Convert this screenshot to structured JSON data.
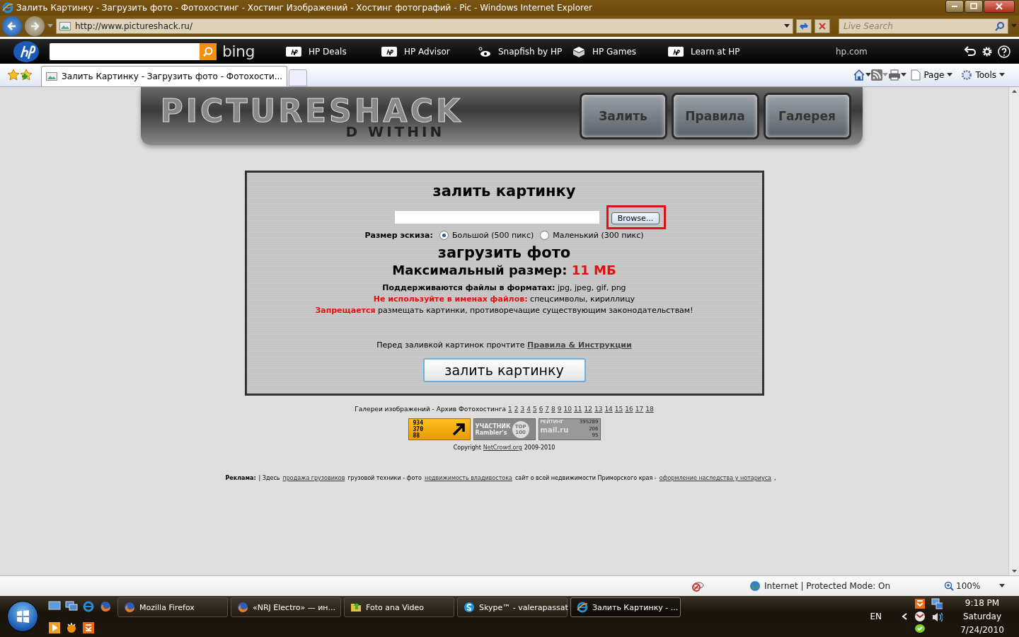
{
  "window": {
    "title": "Залить Картинку - Загрузить фото - Фотохостинг - Хостинг Изображений - Хостинг фотографий - Pic - Windows Internet Explorer"
  },
  "address_bar": {
    "url": "http://www.pictureshack.ru/",
    "search_placeholder": "Live Search"
  },
  "hp_toolbar": {
    "search_brand": "bing",
    "links": [
      "HP Deals",
      "HP Advisor",
      "Snapfish by HP",
      "HP Games",
      "Learn at HP"
    ],
    "site": "hp.com"
  },
  "tabs": [
    {
      "label": "Залить Картинку - Загрузить фото - Фотохости...",
      "selected": true
    }
  ],
  "command_bar": [
    "Page",
    "Tools"
  ],
  "site": {
    "logo": [
      "PICTURESHACK",
      "D WITHIN"
    ],
    "nav": [
      "Залить",
      "Правила",
      "Галерея"
    ]
  },
  "upload": {
    "title": "залить картинку",
    "browse_button": "Browse...",
    "browse_highlighted": true,
    "thumb_label": "Размер эскиза:",
    "size_options": [
      {
        "label": "Большой (500 пикс)",
        "selected": true
      },
      {
        "label": "Маленький (300 пикс)",
        "selected": false
      }
    ],
    "subtitle": "загрузить фото",
    "max_size_label": "Максимальный размер:",
    "max_size_value": "11 МБ",
    "notes": [
      {
        "kind": "info",
        "lead": "Поддерживаются файлы в форматах:",
        "text": "jpg, jpeg, gif, png"
      },
      {
        "kind": "warning",
        "lead": "Не используйте в именах файлов:",
        "text": "спецсимволы, кириллицу"
      },
      {
        "kind": "warning",
        "lead": "Запрещается",
        "text": "размещать картинки, противоречащие существующим законодательствам!"
      }
    ],
    "rules_text": "Перед заливкой картинок прочтите",
    "rules_link": "Правила & Инструкции",
    "submit_button": "залить картинку"
  },
  "galleries": {
    "label": "Галереи изображений - Архив Фотохостинга",
    "pages": [
      "1",
      "2",
      "3",
      "4",
      "5",
      "6",
      "7",
      "8",
      "9",
      "10",
      "11",
      "12",
      "13",
      "14",
      "15",
      "16",
      "17",
      "18"
    ]
  },
  "counters": [
    {
      "kind": "liveinternet",
      "lines": [
        "934",
        "370",
        "88"
      ]
    },
    {
      "kind": "rambler",
      "lines": [
        "УЧАСТНИК",
        "Rambler's",
        "TOP",
        "100"
      ]
    },
    {
      "kind": "mail",
      "lines": [
        "РЕЙТИНГ",
        "395289",
        "206",
        "95",
        "mail.ru"
      ]
    }
  ],
  "copyright": {
    "text": "Copyright",
    "link": "NetCrowd.org",
    "years": "2009-2010"
  },
  "ads": {
    "label": "Реклама:",
    "parts": [
      {
        "kind": "text",
        "text": "|  Здесь"
      },
      {
        "kind": "link",
        "text": "продажа грузовиков"
      },
      {
        "kind": "text",
        "text": "грузовой техники - фото"
      },
      {
        "kind": "link",
        "text": "недвижимость владивостока"
      },
      {
        "kind": "text",
        "text": "сайт о всей недвижимости Приморского края -"
      },
      {
        "kind": "link",
        "text": "оформление наследства у нотариуса"
      },
      {
        "kind": "text",
        "text": ","
      }
    ]
  },
  "status_bar": {
    "zone": "Internet | Protected Mode: On",
    "zoom": "100%"
  },
  "taskbar": {
    "items": [
      {
        "kind": "firefox",
        "label": "Mozilla Firefox",
        "selected": false
      },
      {
        "kind": "firefox",
        "label": "«NRJ Electro» — ин...",
        "selected": false
      },
      {
        "kind": "folder",
        "label": "Foto ana Video",
        "selected": false
      },
      {
        "kind": "skype",
        "label": "Skype™ - valerapassat",
        "selected": false
      },
      {
        "kind": "ie",
        "label": "Залить Картинку - ...",
        "selected": true
      }
    ],
    "language": "EN",
    "clock": {
      "time": "9:18 PM",
      "day": "Saturday",
      "date": "7/24/2010"
    }
  }
}
